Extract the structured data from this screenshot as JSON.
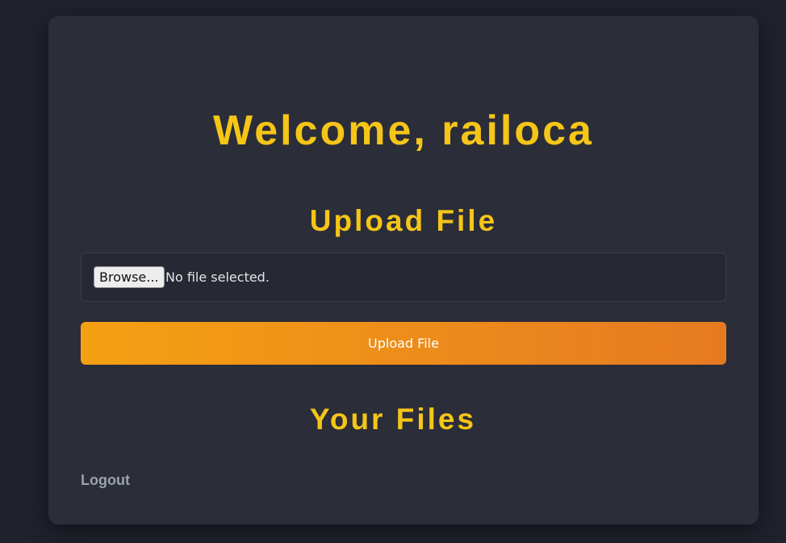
{
  "header": {
    "welcome_text": "Welcome, railoca"
  },
  "upload_section": {
    "title": "Upload File",
    "browse_label": "Browse...",
    "file_status": "No file selected.",
    "submit_label": "Upload File"
  },
  "files_section": {
    "title": "Your Files"
  },
  "footer": {
    "logout_label": "Logout"
  },
  "colors": {
    "background": "#1f222c",
    "card": "#2b2d38",
    "heading": "#f5c518",
    "button_gradient_start": "#f5a012",
    "button_gradient_end": "#e67a22",
    "logout": "#9aa3ad"
  }
}
